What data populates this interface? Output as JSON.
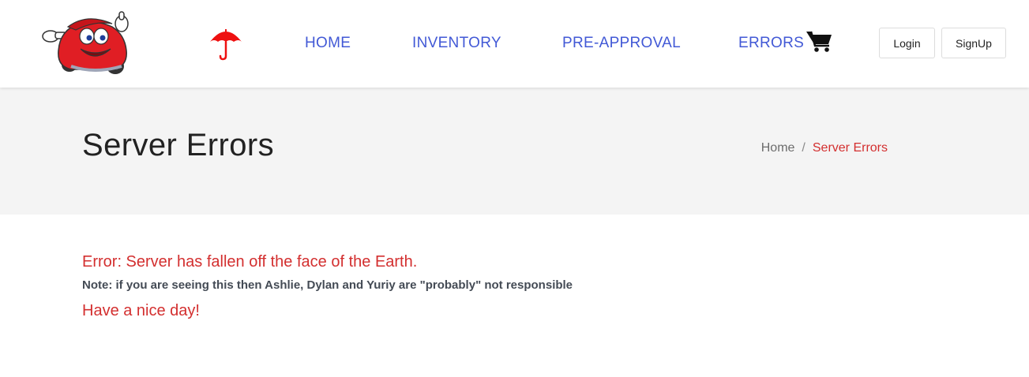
{
  "header": {
    "logo_icon": "cartoon-car-logo-icon",
    "umbrella_icon": "umbrella-icon",
    "cart_icon": "shopping-cart-icon",
    "nav": [
      {
        "label": "HOME"
      },
      {
        "label": "INVENTORY"
      },
      {
        "label": "PRE-APPROVAL"
      },
      {
        "label": "ERRORS"
      }
    ],
    "login_label": "Login",
    "signup_label": "SignUp",
    "nav_color": "#4259d6"
  },
  "banner": {
    "title": "Server Errors",
    "breadcrumb": {
      "home": "Home",
      "separator": "/",
      "current": "Server Errors"
    }
  },
  "content": {
    "error": "Error: Server has fallen off the face of the Earth.",
    "note": "Note: if you are seeing this then Ashlie, Dylan and Yuriy are \"probably\" not responsible",
    "farewell": "Have a nice day!"
  },
  "colors": {
    "accent_red": "#d32f2f",
    "banner_bg": "#f4f4f4"
  }
}
